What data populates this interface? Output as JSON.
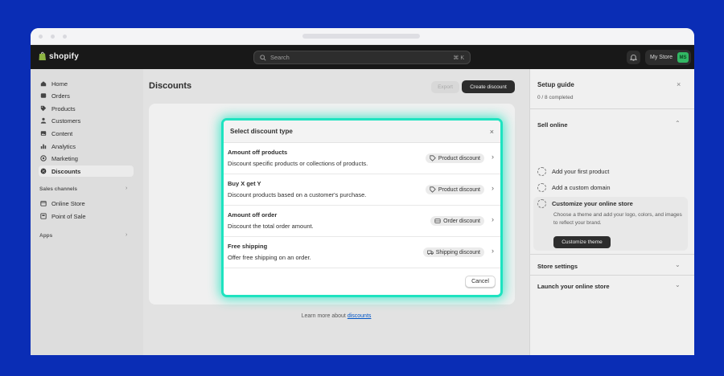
{
  "topbar": {
    "brand": "shopify",
    "search_placeholder": "Search",
    "search_shortcut": "⌘ K",
    "store_name": "My Store",
    "avatar_initials": "MS"
  },
  "sidebar": {
    "items": [
      {
        "label": "Home",
        "icon": "home-icon"
      },
      {
        "label": "Orders",
        "icon": "inbox-icon"
      },
      {
        "label": "Products",
        "icon": "tag-icon"
      },
      {
        "label": "Customers",
        "icon": "person-icon"
      },
      {
        "label": "Content",
        "icon": "image-icon"
      },
      {
        "label": "Analytics",
        "icon": "bar-chart-icon"
      },
      {
        "label": "Marketing",
        "icon": "target-icon"
      },
      {
        "label": "Discounts",
        "icon": "discount-icon",
        "active": true
      }
    ],
    "sales_channels_label": "Sales channels",
    "channels": [
      {
        "label": "Online Store",
        "icon": "store-icon"
      },
      {
        "label": "Point of Sale",
        "icon": "pos-icon"
      }
    ],
    "apps_label": "Apps",
    "chevron": "›"
  },
  "main": {
    "title": "Discounts",
    "export_label": "Export",
    "create_label": "Create discount",
    "learn_prefix": "Learn more about ",
    "learn_link": "discounts"
  },
  "setup_guide": {
    "title": "Setup guide",
    "close": "×",
    "progress": "0 / 8 completed",
    "sell_online": "Sell online",
    "tasks": [
      {
        "label": "Add your first product"
      },
      {
        "label": "Add a custom domain"
      },
      {
        "label": "Customize your online store"
      }
    ],
    "active_task_desc": "Choose a theme and add your logo, colors, and images to reflect your brand.",
    "customize_btn": "Customize theme",
    "store_settings": "Store settings",
    "launch": "Launch your online store"
  },
  "modal": {
    "title": "Select discount type",
    "close": "×",
    "options": [
      {
        "title": "Amount off products",
        "desc": "Discount specific products or collections of products.",
        "badge": "Product discount",
        "badge_icon": "tag-icon"
      },
      {
        "title": "Buy X get Y",
        "desc": "Discount products based on a customer's purchase.",
        "badge": "Product discount",
        "badge_icon": "tag-icon"
      },
      {
        "title": "Amount off order",
        "desc": "Discount the total order amount.",
        "badge": "Order discount",
        "badge_icon": "cart-icon"
      },
      {
        "title": "Free shipping",
        "desc": "Offer free shipping on an order.",
        "badge": "Shipping discount",
        "badge_icon": "truck-icon"
      }
    ],
    "chevron": "›",
    "cancel_label": "Cancel"
  },
  "colors": {
    "background": "#0a2db5",
    "highlight": "#1ee3c0",
    "avatar": "#36c46b"
  }
}
